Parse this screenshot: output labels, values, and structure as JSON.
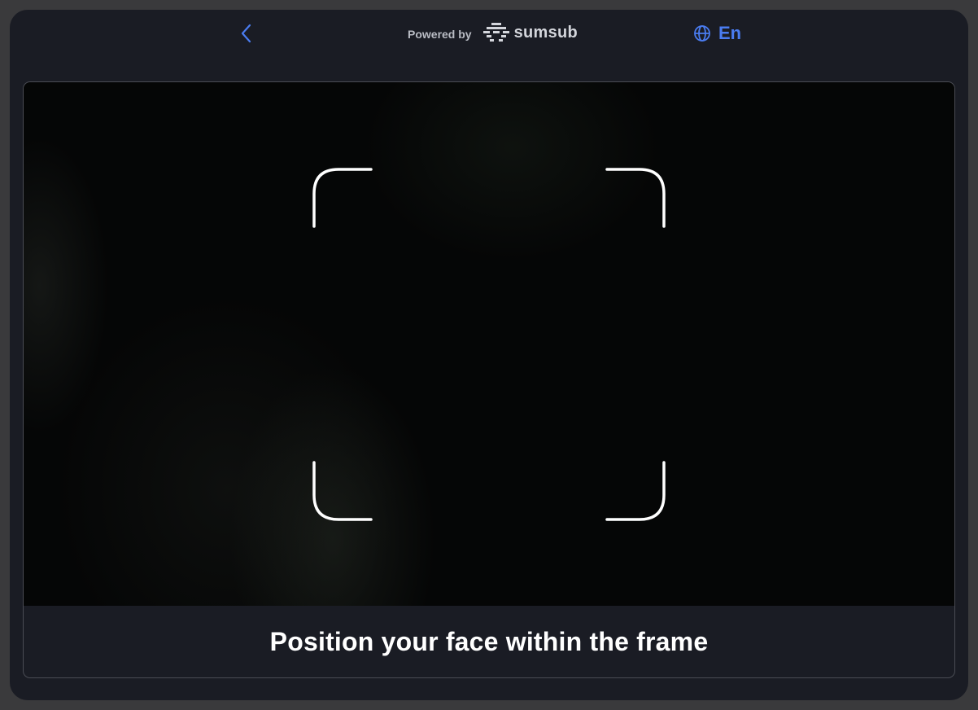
{
  "header": {
    "back_icon": "chevron-left-icon",
    "powered_by": "Powered by",
    "brand_name": "sumsub",
    "brand_logo_icon": "sumsub-logo-icon",
    "language": {
      "icon": "globe-icon",
      "label": "En"
    }
  },
  "camera": {
    "frame_icon": "face-frame-corners-icon",
    "instruction": "Position your face within the frame"
  },
  "colors": {
    "accent": "#4a7cf0",
    "background": "#1a1c24",
    "page_border": "#3a3a3c",
    "text_primary": "#ffffff",
    "text_muted": "#b9bcc4"
  }
}
